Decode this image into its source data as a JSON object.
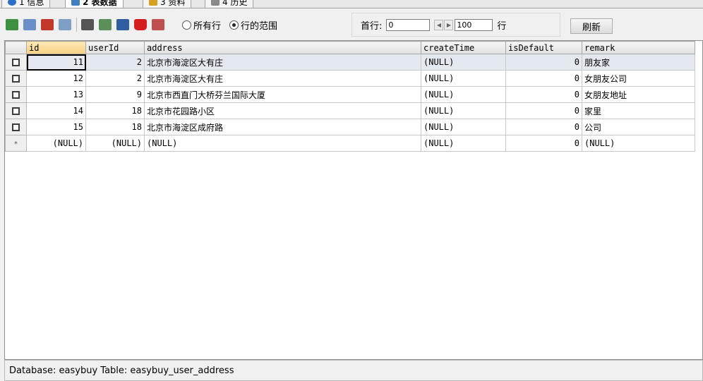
{
  "tabs": [
    {
      "label": "1 信息",
      "active": false,
      "icon": "info-icon",
      "color": "#2a6fc9"
    },
    {
      "label": "2 表数据",
      "active": true,
      "icon": "table-data-icon",
      "color": "#3f7fc0"
    },
    {
      "label": "3 资料",
      "active": false,
      "icon": "info-cube-icon",
      "color": "#d8a020"
    },
    {
      "label": "4 历史",
      "active": false,
      "icon": "history-icon",
      "color": "#8a8a8a"
    }
  ],
  "toolbar": {
    "buttons": [
      {
        "name": "add-row-icon",
        "color": "#3e8f3e"
      },
      {
        "name": "duplicate-row-icon",
        "color": "#6b8fc9"
      },
      {
        "name": "edit-row-icon",
        "color": "#c0392b"
      },
      {
        "name": "view-row-icon",
        "color": "#7f9fc6"
      },
      {
        "name": "filter-icon",
        "color": "#555555"
      },
      {
        "name": "sort-icon",
        "color": "#5a8f5a"
      },
      {
        "name": "save-icon",
        "color": "#2f5fa0"
      },
      {
        "name": "delete-icon",
        "color": "#d41e1e"
      },
      {
        "name": "cancel-icon",
        "color": "#c05050"
      }
    ],
    "radio_all_rows": "所有行",
    "radio_row_range": "行的范围",
    "range_selected": "row_range"
  },
  "range": {
    "first_row_label": "首行:",
    "first_row_value": "0",
    "count_value": "100",
    "rows_label": "行"
  },
  "refresh_label": "刷新",
  "grid": {
    "columns": [
      "id",
      "userId",
      "address",
      "createTime",
      "isDefault",
      "remark"
    ],
    "rows": [
      {
        "marker": "checkbox",
        "id": "11",
        "userId": "2",
        "address": "北京市海淀区大有庄",
        "createTime": "(NULL)",
        "isDefault": "0",
        "remark": "朋友家"
      },
      {
        "marker": "checkbox",
        "id": "12",
        "userId": "2",
        "address": "北京市海淀区大有庄",
        "createTime": "(NULL)",
        "isDefault": "0",
        "remark": "女朋友公司"
      },
      {
        "marker": "checkbox",
        "id": "13",
        "userId": "9",
        "address": "北京市西直门大桥芬兰国际大厦",
        "createTime": "(NULL)",
        "isDefault": "0",
        "remark": "女朋友地址"
      },
      {
        "marker": "checkbox",
        "id": "14",
        "userId": "18",
        "address": "北京市花园路小区",
        "createTime": "(NULL)",
        "isDefault": "0",
        "remark": "家里"
      },
      {
        "marker": "checkbox",
        "id": "15",
        "userId": "18",
        "address": "北京市海淀区成府路",
        "createTime": "(NULL)",
        "isDefault": "0",
        "remark": "公司"
      },
      {
        "marker": "*",
        "id": "(NULL)",
        "userId": "(NULL)",
        "address": "(NULL)",
        "createTime": "(NULL)",
        "isDefault": "0",
        "remark": "(NULL)"
      }
    ]
  },
  "status": "Database: easybuy Table: easybuy_user_address"
}
